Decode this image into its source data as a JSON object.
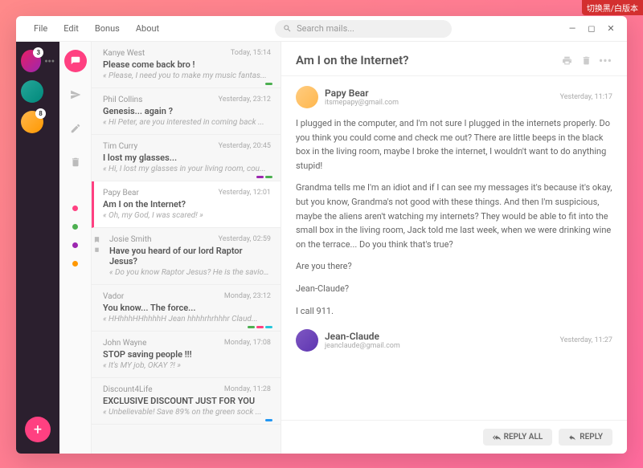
{
  "topBadge": "切换黑/白版本",
  "menu": {
    "file": "File",
    "edit": "Edit",
    "bonus": "Bonus",
    "about": "About"
  },
  "search": {
    "placeholder": "Search mails..."
  },
  "rail": {
    "accounts": [
      {
        "count": "3"
      },
      {
        "count": ""
      },
      {
        "count": "8"
      }
    ]
  },
  "colors": {
    "pink": "#ff4081",
    "green": "#4caf50",
    "purple": "#9c27b0",
    "orange": "#ff9800",
    "cyan": "#26c6da",
    "blue": "#2196f3"
  },
  "mails": [
    {
      "from": "Kanye West",
      "time": "Today, 15:14",
      "subject": "Please come back bro !",
      "preview": "« Please, I need you to make my music fantas...",
      "tags": [
        "#4caf50"
      ]
    },
    {
      "from": "Phil Collins",
      "time": "Yesterday, 23:12",
      "subject": "Genesis... again ?",
      "preview": "« Hi Peter, are you interested in coming back ..."
    },
    {
      "from": "Tim Curry",
      "time": "Yesterday, 20:45",
      "subject": "I lost my glasses...",
      "preview": "« Hi, I lost my glasses in your living room, cou...",
      "tags": [
        "#9c27b0",
        "#4caf50"
      ]
    },
    {
      "from": "Papy Bear",
      "time": "Yesterday, 12:01",
      "subject": "Am I on the Internet?",
      "preview": "« Oh, my God, I was scared! »",
      "selected": true
    },
    {
      "from": "Josie Smith",
      "time": "Yesterday, 02:59",
      "subject": "Have you heard of our lord Raptor Jesus?",
      "preview": "« Do you know Raptor Jesus? He is the savior...",
      "icons": true
    },
    {
      "from": "Vador",
      "time": "Monday, 23:12",
      "subject": "You know... The force...",
      "preview": "« HHhhhHHhhhhH Jean hhhhrhrhhhr Claud...",
      "tags": [
        "#4caf50",
        "#ff4081",
        "#26c6da"
      ]
    },
    {
      "from": "John Wayne",
      "time": "Monday, 17:08",
      "subject": "STOP saving people !!!",
      "preview": "« It's MY job, OKAY ?! »"
    },
    {
      "from": "Discount4Life",
      "time": "Monday, 11:28",
      "subject": "EXCLUSIVE DISCOUNT JUST FOR YOU",
      "preview": "« Unbelievable! Save 89% on the green sock ...",
      "tags": [
        "#2196f3"
      ]
    }
  ],
  "reader": {
    "title": "Am I on the Internet?",
    "messages": [
      {
        "name": "Papy Bear",
        "email": "itsmepapy@gmail.com",
        "time": "Yesterday, 11:17",
        "body": [
          "I plugged in the computer, and I'm not sure I plugged in the internets properly. Do you think you could come and check me out? There are little beeps in the black box in the living room, maybe I broke the internet, I wouldn't want to do anything stupid!",
          "Grandma tells me I'm an idiot and if I can see my messages it's because it's okay, but you know, Grandma's not good with these things. And then I'm suspicious, maybe the aliens aren't watching my internets? They would be able to fit into the small box in the living room, Jack told me last week, when we were drinking wine on the terrace... Do you think that's true?",
          "Are you there?",
          "Jean-Claude?",
          "I call 911."
        ]
      },
      {
        "name": "Jean-Claude",
        "email": "jeanclaude@gmail.com",
        "time": "Yesterday, 11:27",
        "body": []
      }
    ],
    "replyAll": "REPLY ALL",
    "reply": "REPLY"
  }
}
